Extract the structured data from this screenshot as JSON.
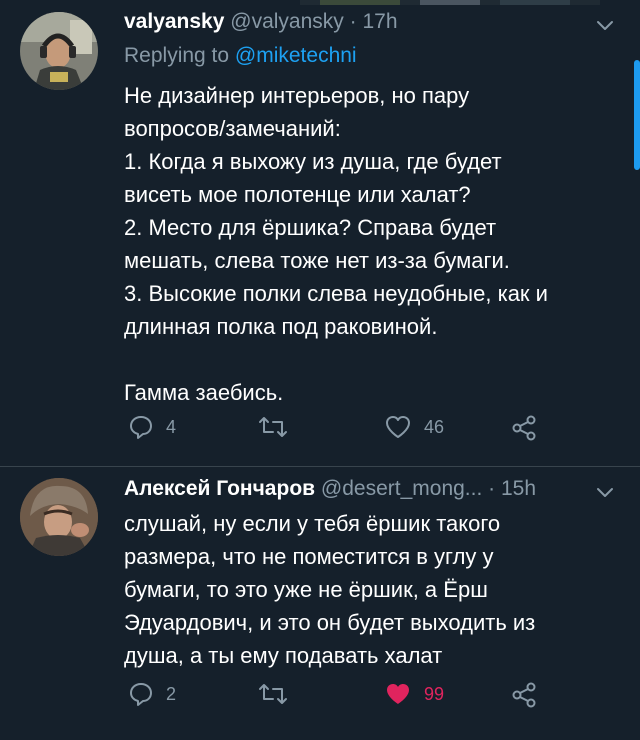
{
  "tweets": [
    {
      "name": "valyansky",
      "handle": "@valyansky",
      "separator": "·",
      "time": "17h",
      "reply_prefix": "Replying to",
      "reply_mention": "@miketechni",
      "text": "Не дизайнер интерьеров, но пару\nвопросов/замечаний:\n1. Когда я выхожу из душа, где будет\nвисеть мое полотенце или халат?\n2. Место для ёршика? Справа будет\nмешать, слева тоже нет из-за бумаги.\n3. Высокие полки слева неудобные, как и\nдлинная полка под раковиной.\n\nГамма заебись.",
      "replies": "4",
      "retweets": "",
      "likes": "46",
      "liked": false,
      "avatar": "avatar-photo-man-with-headphones"
    },
    {
      "name": "Алексей Гончаров",
      "handle": "@desert_mong...",
      "separator": "·",
      "time": "15h",
      "text": "слушай, ну если у тебя ёршик такого\nразмера, что не поместится в углу у\nбумаги, то это уже не ёршик, а Ёрш\nЭдуардович, и это он будет выходить из\nдуша, а ты ему подавать халат",
      "replies": "2",
      "retweets": "",
      "likes": "99",
      "liked": true,
      "avatar": "avatar-photo-man-in-fur-hat"
    }
  ],
  "icons": {
    "reply": "reply-icon",
    "retweet": "retweet-icon",
    "like": "heart-icon",
    "share": "share-icon",
    "menu": "chevron-down-icon"
  },
  "colors": {
    "background": "#15202b",
    "secondary_text": "#8899a6",
    "mention": "#1da1f2",
    "like_active": "#e0245e",
    "divider": "#38444d"
  }
}
